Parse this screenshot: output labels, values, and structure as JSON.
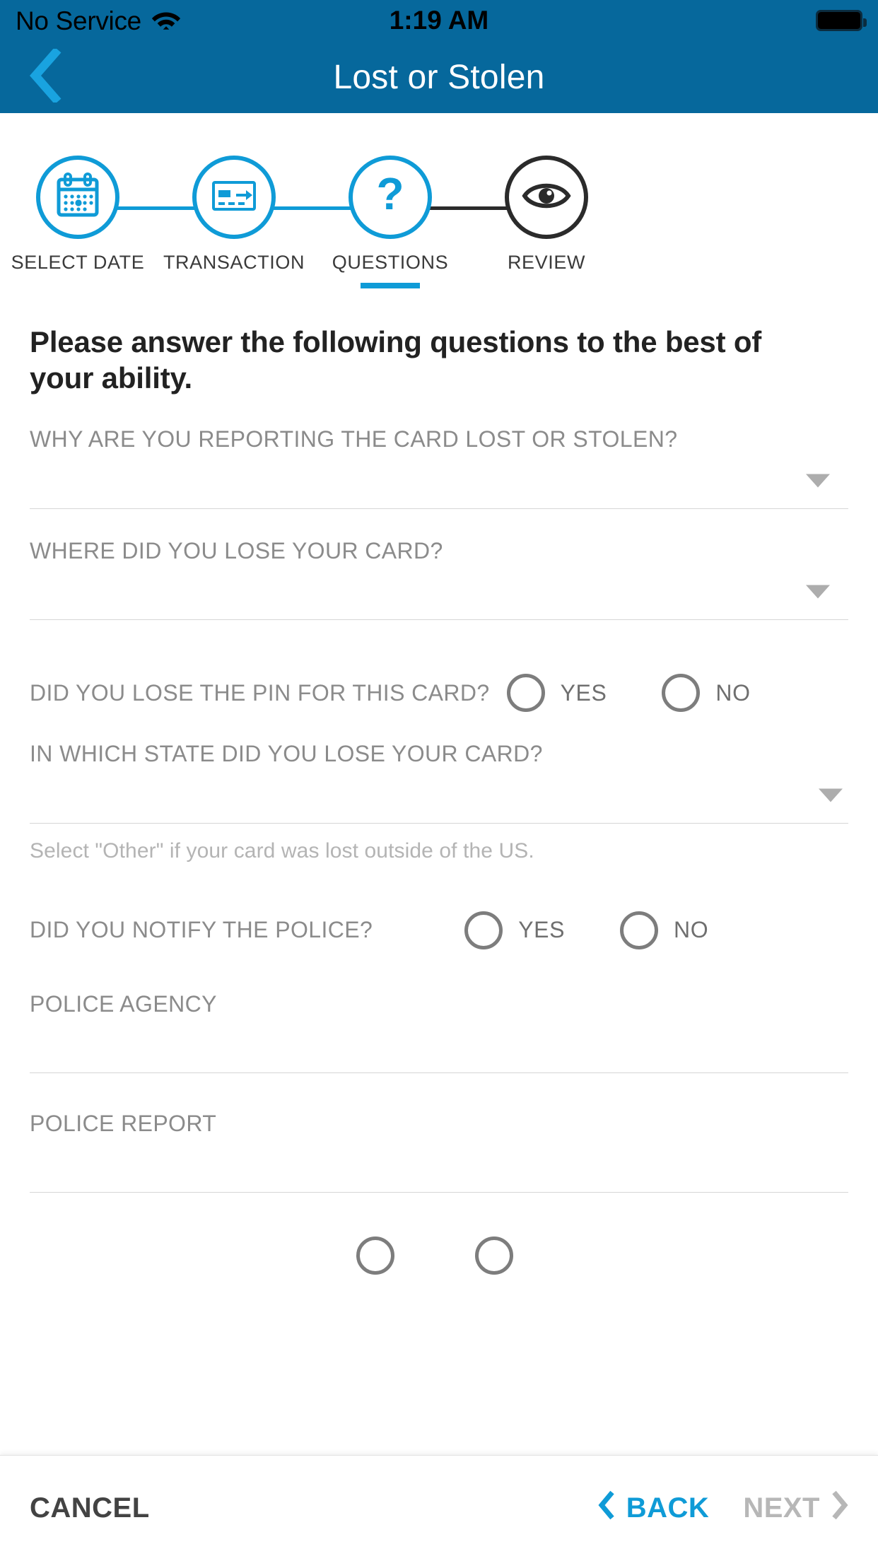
{
  "statusbar": {
    "carrier": "No Service",
    "wifi_icon": "wifi-icon",
    "time": "1:19 AM",
    "battery_icon": "battery-full-icon"
  },
  "navbar": {
    "back_icon": "chevron-left-icon",
    "title": "Lost or Stolen"
  },
  "stepper": {
    "steps": [
      {
        "label": "SELECT DATE",
        "icon": "calendar-icon",
        "state": "active"
      },
      {
        "label": "TRANSACTION",
        "icon": "card-transfer-icon",
        "state": "active"
      },
      {
        "label": "QUESTIONS",
        "icon": "question-mark-icon",
        "state": "current"
      },
      {
        "label": "REVIEW",
        "icon": "eye-icon",
        "state": "inactive"
      }
    ],
    "active_color": "#0f9bd7",
    "inactive_color": "#2b2b2b"
  },
  "main": {
    "headline": "Please answer the following questions to the best of your ability.",
    "fields": {
      "reason": {
        "label": "WHY ARE YOU REPORTING THE CARD LOST OR STOLEN?",
        "value": "",
        "caret_icon": "chevron-down-icon"
      },
      "where": {
        "label": "WHERE DID YOU LOSE YOUR CARD?",
        "value": "",
        "caret_icon": "chevron-down-icon"
      },
      "pin": {
        "label": "DID YOU LOSE THE PIN FOR THIS CARD?",
        "yes": "YES",
        "no": "NO",
        "selected": ""
      },
      "state": {
        "label": "IN WHICH STATE DID YOU LOSE YOUR CARD?",
        "value": "",
        "caret_icon": "chevron-down-icon",
        "helper": "Select \"Other\" if your card was lost outside of the US."
      },
      "police_notified": {
        "label": "DID YOU NOTIFY THE POLICE?",
        "yes": "YES",
        "no": "NO",
        "selected": ""
      },
      "police_agency": {
        "label": "POLICE AGENCY",
        "value": ""
      },
      "police_report": {
        "label": "POLICE REPORT",
        "value": ""
      }
    }
  },
  "footer": {
    "cancel": "CANCEL",
    "back": "BACK",
    "next": "NEXT",
    "back_icon": "chevron-left-icon",
    "next_icon": "chevron-right-icon"
  },
  "colors": {
    "header_blue": "#06689c",
    "accent_blue": "#0f9bd7",
    "label_gray": "#8b8b8b",
    "disabled_gray": "#b7b7b7"
  }
}
